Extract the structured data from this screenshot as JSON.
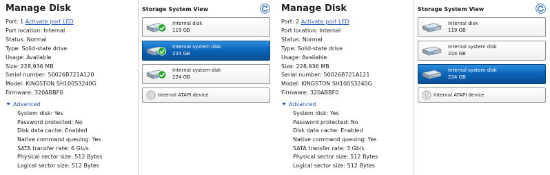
{
  "colors": {
    "accent": "#2a56c6",
    "selected_start": "#2d8ee0",
    "selected_end": "#0a4f95",
    "check_green": "#2fa52f"
  },
  "panels": [
    {
      "title": "Manage Disk",
      "port_label": "Port: 1",
      "activate_led": "Activate port LED",
      "port_location": "Port location: Internal",
      "status": "Status: Normal",
      "type": "Type: Solid-state drive",
      "usage": "Usage: Available",
      "size": "Size: 228,936 MB",
      "serial": "Serial number: 50026B721A120",
      "model": "Model: KINGSTON SH100S3240G",
      "firmware": "Firmware: 320ABBF0",
      "advanced_label": "Advanced",
      "advanced": [
        "System disk: Yes",
        "Password protected: No",
        "Disk data cache: Enabled",
        "Native command queuing: Yes",
        "SATA transfer rate: 6 Gb/s",
        "Physical sector size: 512 Bytes",
        "Logical sector size: 512 Bytes"
      ],
      "storage_title": "Storage System View",
      "refresh_icon": "refresh-icon",
      "disks": [
        {
          "name": "Internal disk",
          "size": "119 GB",
          "selected": false
        },
        {
          "name": "Internal system disk",
          "size": "224 GB",
          "selected": true
        },
        {
          "name": "Internal system disk",
          "size": "224 GB",
          "selected": false
        }
      ],
      "atapi": "Internal ATAPI device"
    },
    {
      "title": "Manage Disk",
      "port_label": "Port: 2",
      "activate_led": "Activate port LED",
      "port_location": "Port location: Internal",
      "status": "Status: Normal",
      "type": "Type: Solid-state drive",
      "usage": "Usage: Available",
      "size": "Size: 228,936 MB",
      "serial": "Serial number: 50026B721A121",
      "model": "Model: KINGSTON SH100S3240G",
      "firmware": "Firmware: 320ABBF0",
      "advanced_label": "Advanced",
      "advanced": [
        "System disk: Yes",
        "Password protected: No",
        "Disk data cache: Enabled",
        "Native command queuing: Yes",
        "SATA transfer rate: 3 Gb/s",
        "Physical sector size: 512 Bytes",
        "Logical sector size: 512 Bytes"
      ],
      "storage_title": "Storage System View",
      "refresh_icon": "refresh-icon",
      "disks": [
        {
          "name": "Internal disk",
          "size": "119 GB",
          "selected": false
        },
        {
          "name": "Internal system disk",
          "size": "224 GB",
          "selected": false
        },
        {
          "name": "Internal system disk",
          "size": "224 GB",
          "selected": true
        }
      ],
      "atapi": "Internal ATAPI device"
    }
  ]
}
